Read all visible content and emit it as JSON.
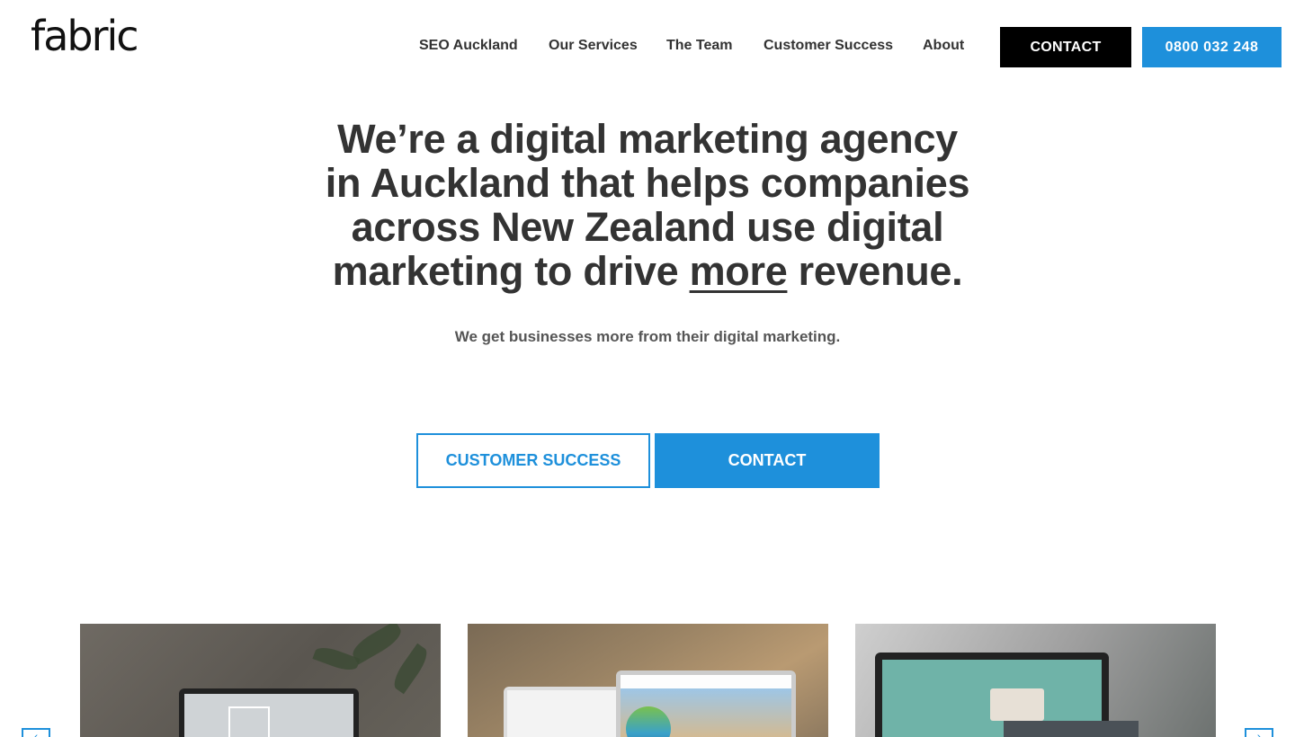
{
  "header": {
    "logo": "fabric",
    "nav": [
      "SEO Auckland",
      "Our Services",
      "The Team",
      "Customer Success",
      "About"
    ],
    "contact_label": "CONTACT",
    "phone_label": "0800 032 248"
  },
  "hero": {
    "title_line1": "We’re a digital marketing agency",
    "title_line2": "in Auckland that helps companies",
    "title_line3": "across New Zealand use digital",
    "title_line4_pre": "marketing to drive ",
    "title_line4_underlined": "more",
    "title_line4_post": " revenue.",
    "subtitle": "We get businesses more from their digital marketing.",
    "btn_customer_success": "CUSTOMER SUCCESS",
    "btn_contact": "CONTACT"
  },
  "carousel": {
    "prev_icon": "‹",
    "next_icon": "›"
  },
  "colors": {
    "accent": "#1e90db",
    "text": "#333333",
    "black": "#000000"
  }
}
